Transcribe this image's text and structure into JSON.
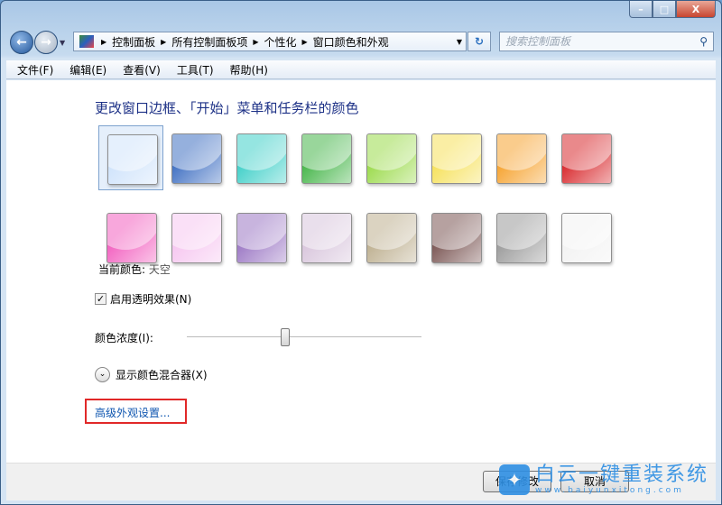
{
  "window": {
    "controls": {
      "minimize": "–",
      "maximize": "□",
      "close": "X"
    }
  },
  "nav": {
    "back_icon": "arrow-left",
    "forward_icon": "arrow-right",
    "breadcrumb": [
      "控制面板",
      "所有控制面板项",
      "个性化",
      "窗口颜色和外观"
    ],
    "search_placeholder": "搜索控制面板"
  },
  "menu": [
    "文件(F)",
    "编辑(E)",
    "查看(V)",
    "工具(T)",
    "帮助(H)"
  ],
  "main": {
    "title": "更改窗口边框、「开始」菜单和任务栏的颜色",
    "swatches": [
      {
        "name": "sky",
        "color": "#cfe3fb",
        "selected": true
      },
      {
        "name": "twilight",
        "color": "#3f6fc2"
      },
      {
        "name": "sea",
        "color": "#3fcfc8"
      },
      {
        "name": "leaf",
        "color": "#45b549"
      },
      {
        "name": "lime",
        "color": "#9ada4a"
      },
      {
        "name": "yellow",
        "color": "#f6e15a"
      },
      {
        "name": "orange",
        "color": "#f6a22e"
      },
      {
        "name": "red",
        "color": "#d8282c"
      },
      {
        "name": "fuchsia",
        "color": "#f25fbf"
      },
      {
        "name": "pink",
        "color": "#f6c6f0"
      },
      {
        "name": "violet",
        "color": "#9b77c4"
      },
      {
        "name": "lavender",
        "color": "#d8c5dc"
      },
      {
        "name": "taupe",
        "color": "#bdaf8f"
      },
      {
        "name": "chocolate",
        "color": "#7a5553"
      },
      {
        "name": "slate",
        "color": "#9a9a9a"
      },
      {
        "name": "frost",
        "color": "#f2f2f2"
      }
    ],
    "current_label": "当前颜色:",
    "current_value": "天空",
    "transparency_label": "启用透明效果(N)",
    "transparency_checked": true,
    "intensity_label": "颜色浓度(I):",
    "intensity_percent": 42,
    "mixer_label": "显示颜色混合器(X)",
    "advanced_link": "高级外观设置..."
  },
  "footer": {
    "save": "保存修改",
    "cancel": "取消"
  },
  "watermark": {
    "text": "白云一键重装系统",
    "url": "www.baiyunxitong.com"
  }
}
